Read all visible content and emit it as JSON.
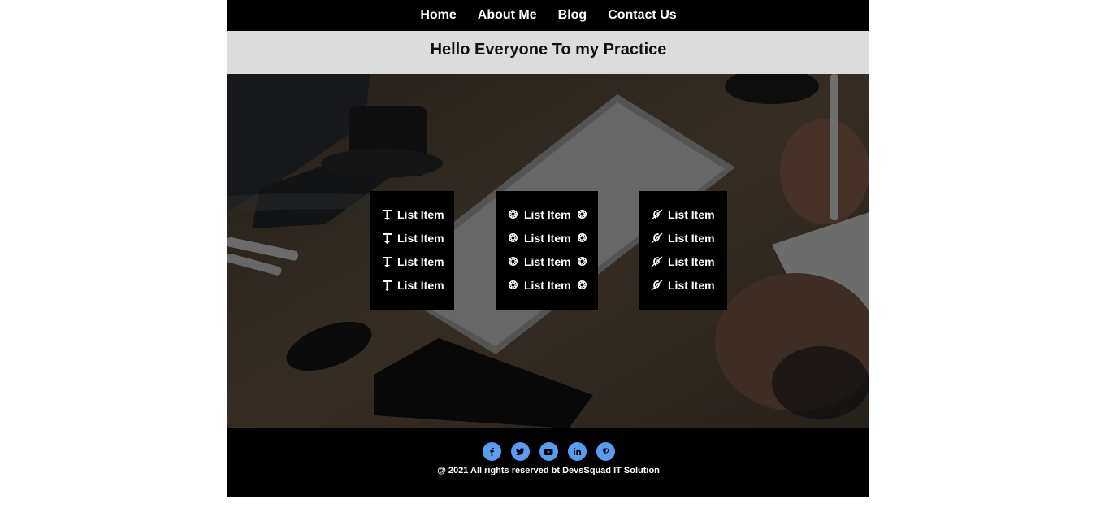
{
  "nav": {
    "items": [
      "Home",
      "About Me",
      "Blog",
      "Contact Us"
    ]
  },
  "header": {
    "title": "Hello Everyone To my Practice"
  },
  "lists": [
    {
      "icon": "text-height-icon",
      "items": [
        "List Item",
        "List Item",
        "List Item",
        "List Item"
      ]
    },
    {
      "icon": "gear-icon",
      "items": [
        "List Item",
        "List Item",
        "List Item",
        "List Item"
      ]
    },
    {
      "icon": "deaf-icon",
      "items": [
        "List Item",
        "List Item",
        "List Item",
        "List Item"
      ]
    }
  ],
  "footer": {
    "socials": [
      "facebook-icon",
      "twitter-icon",
      "youtube-icon",
      "linkedin-icon",
      "pinterest-icon"
    ],
    "social_color": "#5b9bf0",
    "copyright": "@ 2021 All rights reserved bt DevsSquad IT Solution"
  }
}
